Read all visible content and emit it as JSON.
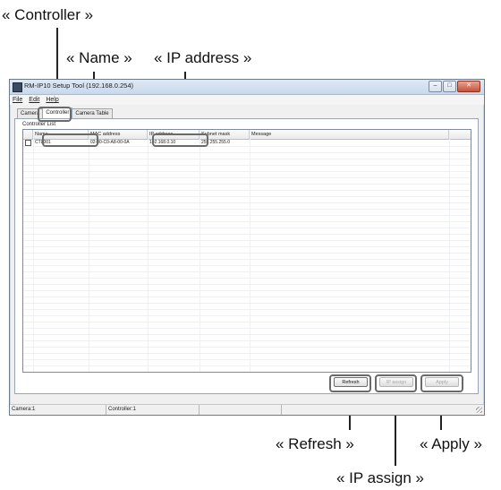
{
  "callouts": {
    "controller": "« Controller »",
    "name": "« Name »",
    "ip_address": "« IP address »",
    "refresh": "« Refresh »",
    "apply": "« Apply »",
    "ip_assign": "« IP assign »"
  },
  "window": {
    "title": "RM-IP10 Setup Tool (192.168.0.254)",
    "menu": [
      "File",
      "Edit",
      "Help"
    ]
  },
  "tabs": [
    "Camera",
    "Controller",
    "Camera Table"
  ],
  "controller_list": {
    "group_label": "Controller List",
    "columns": [
      "",
      "Name",
      "MAC address",
      "IP address",
      "Subnet mask",
      "Message"
    ],
    "rows": [
      {
        "name": "CTL001",
        "mac": "02-00-C0-A8-00-0A",
        "ip": "192.168.0.10",
        "subnet": "255.255.255.0",
        "message": ""
      }
    ]
  },
  "buttons": {
    "refresh": "Refresh",
    "ip_assign": "IP assign",
    "apply": "Apply"
  },
  "status": {
    "camera": "Camera:1",
    "controller": "Controller:1"
  },
  "colors": {
    "highlight_border": "#6a6a6a",
    "titlebar": "#c8d8ec"
  }
}
